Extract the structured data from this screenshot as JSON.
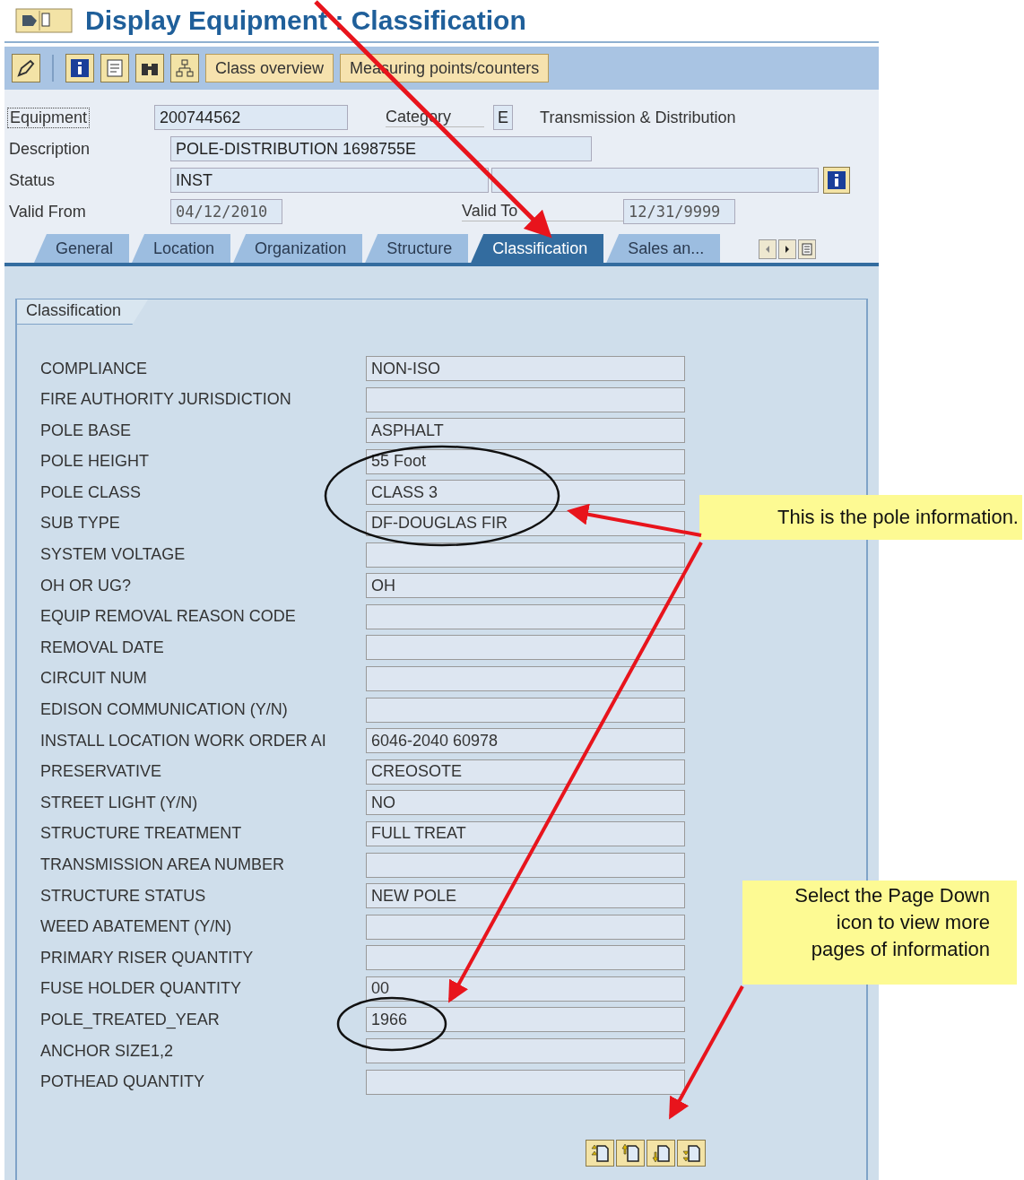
{
  "window": {
    "title": "Display Equipment : Classification"
  },
  "toolbar": {
    "buttons": [
      {
        "label": "Class overview"
      },
      {
        "label": "Measuring points/counters"
      }
    ]
  },
  "header": {
    "equipment": {
      "label": "Equipment",
      "value": "200744562"
    },
    "category": {
      "label": "Category",
      "value": "E",
      "text": "Transmission & Distribution"
    },
    "description": {
      "label": "Description",
      "value": "POLE-DISTRIBUTION 1698755E"
    },
    "status": {
      "label": "Status",
      "value": "INST"
    },
    "valid_from": {
      "label": "Valid From",
      "value": "04/12/2010"
    },
    "valid_to": {
      "label": "Valid To",
      "value": "12/31/9999"
    }
  },
  "tabs": [
    {
      "label": "General",
      "selected": false
    },
    {
      "label": "Location",
      "selected": false
    },
    {
      "label": "Organization",
      "selected": false
    },
    {
      "label": "Structure",
      "selected": false
    },
    {
      "label": "Classification",
      "selected": true
    },
    {
      "label": "Sales an...",
      "selected": false
    }
  ],
  "section": {
    "title": "Classification"
  },
  "characteristics": [
    {
      "label": "COMPLIANCE",
      "value": "NON-ISO"
    },
    {
      "label": "FIRE AUTHORITY JURISDICTION"
    },
    {
      "label": "POLE BASE",
      "value": "ASPHALT"
    },
    {
      "label": "POLE HEIGHT",
      "value": "55 Foot"
    },
    {
      "label": "POLE CLASS",
      "value": "CLASS 3"
    },
    {
      "label": "SUB TYPE",
      "value": "DF-DOUGLAS FIR"
    },
    {
      "label": "SYSTEM VOLTAGE"
    },
    {
      "label": "OH OR UG?",
      "value": "OH"
    },
    {
      "label": "EQUIP REMOVAL REASON CODE"
    },
    {
      "label": "REMOVAL DATE"
    },
    {
      "label": "CIRCUIT NUM"
    },
    {
      "label": "EDISON COMMUNICATION (Y/N)"
    },
    {
      "label": "INSTALL LOCATION WORK ORDER AI",
      "value": "6046-2040 60978"
    },
    {
      "label": "PRESERVATIVE",
      "value": "CREOSOTE"
    },
    {
      "label": "STREET LIGHT (Y/N)",
      "value": "NO"
    },
    {
      "label": "STRUCTURE TREATMENT",
      "value": "FULL TREAT"
    },
    {
      "label": "TRANSMISSION AREA NUMBER"
    },
    {
      "label": "STRUCTURE STATUS",
      "value": "NEW POLE"
    },
    {
      "label": "WEED ABATEMENT (Y/N)"
    },
    {
      "label": "PRIMARY RISER QUANTITY"
    },
    {
      "label": "FUSE HOLDER QUANTITY",
      "value": "00"
    },
    {
      "label": "POLE_TREATED_YEAR",
      "value": "1966"
    },
    {
      "label": "ANCHOR SIZE1,2"
    },
    {
      "label": "POTHEAD QUANTITY"
    }
  ],
  "callouts": [
    {
      "lines": [
        "This is the pole information."
      ]
    },
    {
      "lines": [
        "Select the Page Down",
        "icon to view more",
        "pages of information"
      ]
    }
  ]
}
